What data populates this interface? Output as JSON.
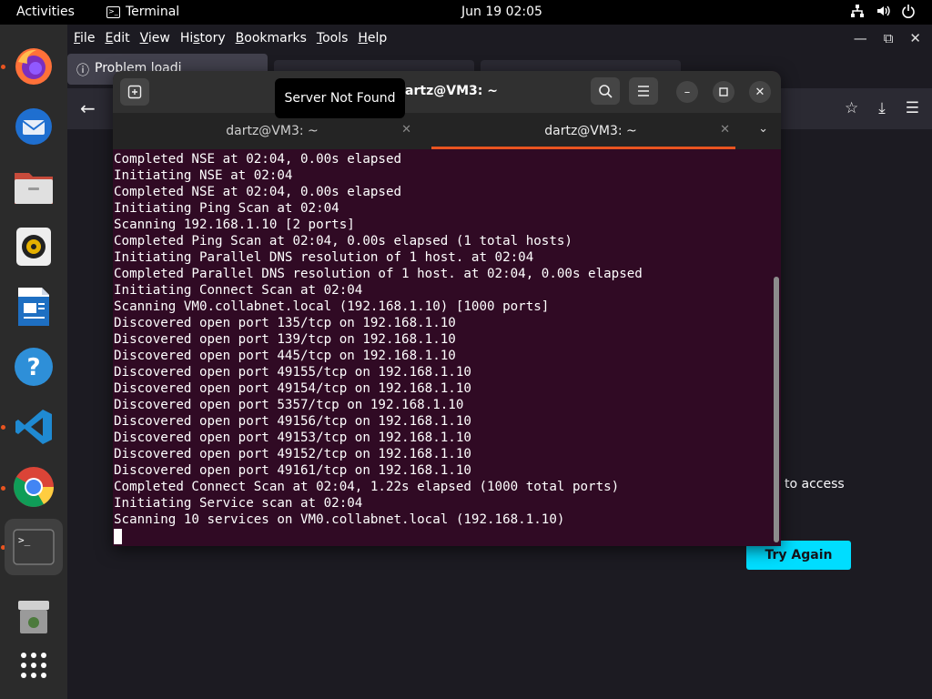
{
  "topbar": {
    "activities": "Activities",
    "app_name": "Terminal",
    "clock": "Jun 19  02:05",
    "icons": [
      "network-icon",
      "volume-icon",
      "power-icon"
    ]
  },
  "dock": {
    "items": [
      {
        "name": "firefox",
        "running": true
      },
      {
        "name": "thunderbird",
        "running": false
      },
      {
        "name": "files",
        "running": false
      },
      {
        "name": "rhythmbox",
        "running": false
      },
      {
        "name": "libreoffice-writer",
        "running": false
      },
      {
        "name": "help",
        "running": false
      },
      {
        "name": "vscode",
        "running": true
      },
      {
        "name": "chrome",
        "running": true
      },
      {
        "name": "terminal",
        "running": true,
        "active": true
      },
      {
        "name": "trash",
        "running": false
      },
      {
        "name": "show-apps",
        "running": false
      }
    ]
  },
  "firefox": {
    "menu": [
      "File",
      "Edit",
      "View",
      "History",
      "Bookmarks",
      "Tools",
      "Help"
    ],
    "tab1_label": "Problem loadi",
    "access_text": "to access",
    "try_again": "Try Again"
  },
  "tooltip": "Server Not Found",
  "terminal": {
    "title": "dartz@VM3: ~",
    "tabs": [
      {
        "label": "dartz@VM3: ~",
        "active": false
      },
      {
        "label": "dartz@VM3: ~",
        "active": true
      }
    ],
    "lines": [
      "Completed NSE at 02:04, 0.00s elapsed",
      "Initiating NSE at 02:04",
      "Completed NSE at 02:04, 0.00s elapsed",
      "Initiating Ping Scan at 02:04",
      "Scanning 192.168.1.10 [2 ports]",
      "Completed Ping Scan at 02:04, 0.00s elapsed (1 total hosts)",
      "Initiating Parallel DNS resolution of 1 host. at 02:04",
      "Completed Parallel DNS resolution of 1 host. at 02:04, 0.00s elapsed",
      "Initiating Connect Scan at 02:04",
      "Scanning VM0.collabnet.local (192.168.1.10) [1000 ports]",
      "Discovered open port 135/tcp on 192.168.1.10",
      "Discovered open port 139/tcp on 192.168.1.10",
      "Discovered open port 445/tcp on 192.168.1.10",
      "Discovered open port 49155/tcp on 192.168.1.10",
      "Discovered open port 49154/tcp on 192.168.1.10",
      "Discovered open port 5357/tcp on 192.168.1.10",
      "Discovered open port 49156/tcp on 192.168.1.10",
      "Discovered open port 49153/tcp on 192.168.1.10",
      "Discovered open port 49152/tcp on 192.168.1.10",
      "Discovered open port 49161/tcp on 192.168.1.10",
      "Completed Connect Scan at 02:04, 1.22s elapsed (1000 total ports)",
      "Initiating Service scan at 02:04",
      "Scanning 10 services on VM0.collabnet.local (192.168.1.10)"
    ]
  },
  "colors": {
    "terminal_bg": "#300a24",
    "accent": "#e95420",
    "try_again_bg": "#00ddff"
  }
}
